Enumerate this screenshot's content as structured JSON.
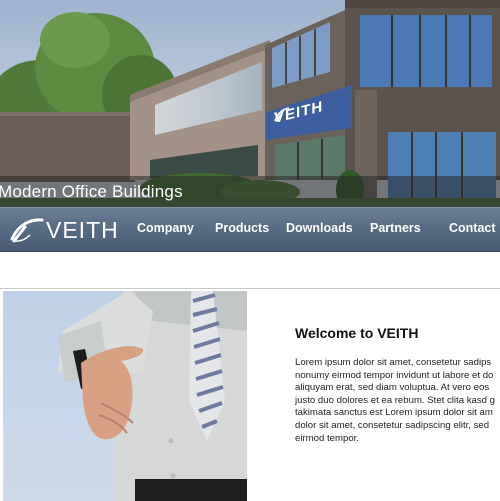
{
  "hero": {
    "caption": "Modern Office Buildings",
    "sign_text": "VEITH"
  },
  "nav": {
    "logo_text": "VEITH",
    "items": [
      "Company",
      "Products",
      "Downloads",
      "Partners",
      "Contact"
    ]
  },
  "main": {
    "title": "Welcome to VEITH",
    "body_lines": [
      "Lorem ipsum dolor sit amet, consetetur sadips",
      "nonumy eirmod tempor invidunt ut labore et do",
      "aliquyam erat, sed diam voluptua. At vero eos",
      "justo duo dolores et ea rebum. Stet clita kasd g",
      "takimata sanctus est Lorem ipsum dolor sit am",
      "dolor sit amet, consetetur sadipscing elitr, sed",
      "eirmod tempor."
    ]
  },
  "colors": {
    "nav_bg": "#566a83",
    "sign_blue": "#3e5f9e",
    "building": "#5f5650"
  },
  "icons": {
    "logo": "veith-swoosh-logo"
  }
}
